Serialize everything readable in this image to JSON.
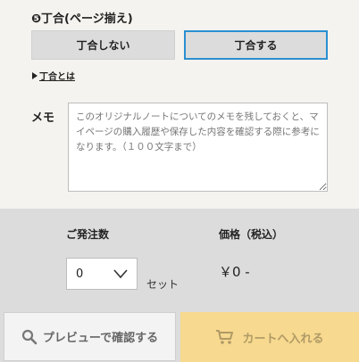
{
  "binding": {
    "title": "❺丁合(ページ揃え)",
    "option_no": "丁合しない",
    "option_yes": "丁合する",
    "info_link": "丁合とは"
  },
  "memo": {
    "label": "メモ",
    "placeholder": "このオリジナルノートについてのメモを残しておくと、マイページの購入履歴や保存した内容を確認する際に参考になります。（１００文字まで）"
  },
  "order": {
    "quantity_label": "ご発注数",
    "quantity_value": "0",
    "unit": "セット",
    "price_label": "価格（税込）",
    "price_value": "￥0 -"
  },
  "actions": {
    "preview_label": "プレビューで確認する",
    "cart_label": "カートへ入れる"
  },
  "colors": {
    "selected_border": "#2a8fd0",
    "cart_button": "#f7d98f"
  }
}
